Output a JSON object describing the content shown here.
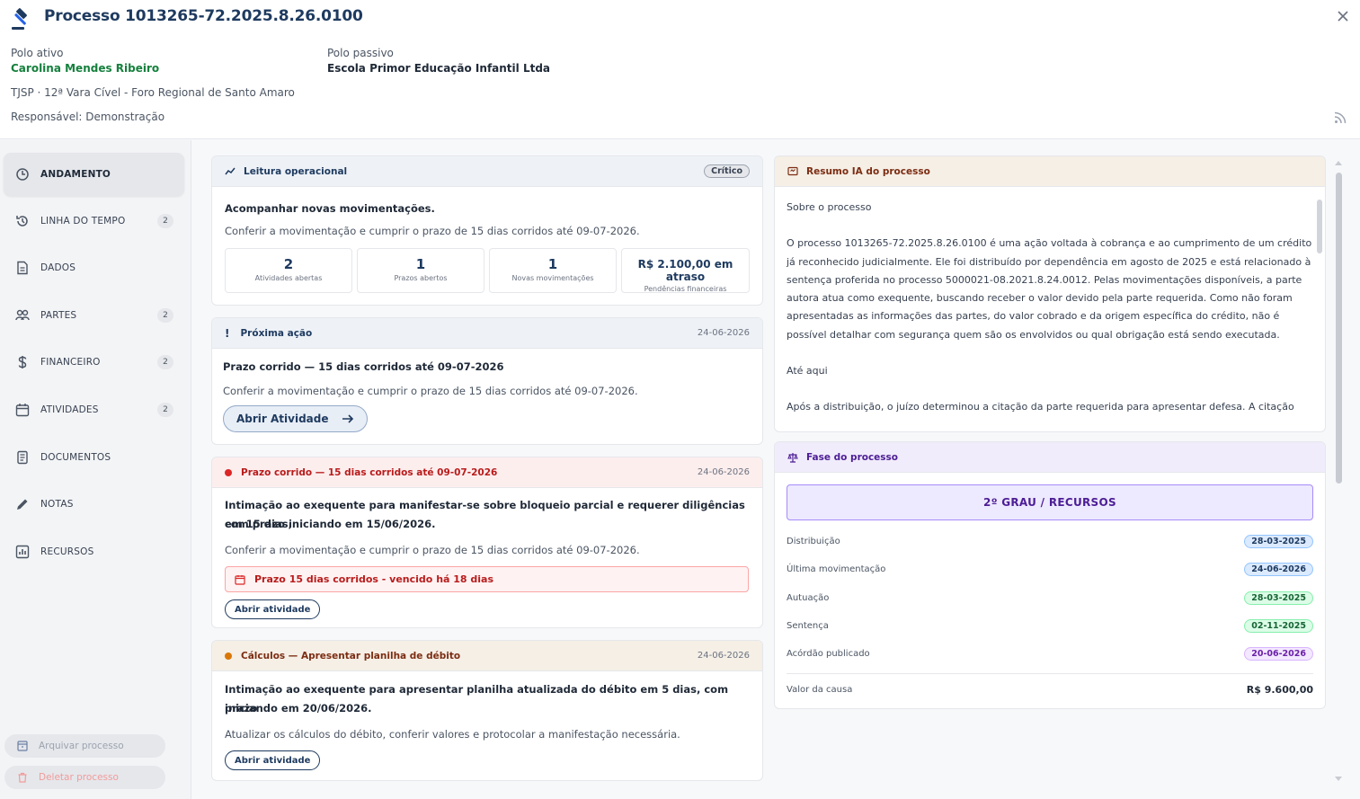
{
  "header": {
    "title": "Processo 1013265-72.2025.8.26.0100",
    "polo_ativo_label": "Polo ativo",
    "polo_ativo_name": "Carolina Mendes Ribeiro",
    "polo_passivo_label": "Polo passivo",
    "polo_passivo_name": "Escola Primor Educação Infantil Ltda",
    "court": "TJSP · 12ª Vara Cível - Foro Regional de Santo Amaro",
    "responsible": "Responsável: Demonstração"
  },
  "sidebar": {
    "items": [
      {
        "label": "ANDAMENTO",
        "count": "",
        "icon": "clock-icon"
      },
      {
        "label": "LINHA DO TEMPO",
        "count": "2",
        "icon": "history-icon"
      },
      {
        "label": "DADOS",
        "count": "",
        "icon": "document-icon"
      },
      {
        "label": "PARTES",
        "count": "2",
        "icon": "users-icon"
      },
      {
        "label": "FINANCEIRO",
        "count": "2",
        "icon": "dollar-icon"
      },
      {
        "label": "ATIVIDADES",
        "count": "2",
        "icon": "calendar-icon"
      },
      {
        "label": "DOCUMENTOS",
        "count": "",
        "icon": "file-icon"
      },
      {
        "label": "NOTAS",
        "count": "",
        "icon": "pencil-icon"
      },
      {
        "label": "RECURSOS",
        "count": "",
        "icon": "chart-icon"
      }
    ],
    "archive_label": "Arquivar processo",
    "delete_label": "Deletar processo"
  },
  "operational": {
    "title": "Leitura operacional",
    "badge": "Crítico",
    "headline": "Acompanhar novas movimentações.",
    "desc": "Conferir a movimentação e cumprir o prazo de 15 dias corridos até 09-07-2026.",
    "stats": [
      {
        "value": "2",
        "label": "Atividades abertas"
      },
      {
        "value": "1",
        "label": "Prazos abertos"
      },
      {
        "value": "1",
        "label": "Novas movimentações"
      },
      {
        "value": "R$ 2.100,00 em atraso",
        "label": "Pendências financeiras"
      }
    ]
  },
  "next_action": {
    "title": "Próxima ação",
    "date": "24-06-2026",
    "headline": "Prazo corrido — 15 dias corridos até 09-07-2026",
    "desc": "Conferir a movimentação e cumprir o prazo de 15 dias corridos até 09-07-2026.",
    "button": "Abrir Atividade"
  },
  "deadline_card": {
    "title": "Prazo corrido — 15 dias corridos até 09-07-2026",
    "date": "24-06-2026",
    "text1": "Intimação ao exequente para manifestar-se sobre bloqueio parcial e requerer diligências em 15 dias,",
    "text2": "com prazo iniciando em 15/06/2026.",
    "desc": "Conferir a movimentação e cumprir o prazo de 15 dias corridos até 09-07-2026.",
    "alert": "Prazo 15 dias corridos - vencido há 18 dias",
    "button": "Abrir atividade"
  },
  "calc_card": {
    "title": "Cálculos — Apresentar planilha de débito",
    "date": "24-06-2026",
    "text1": "Intimação ao exequente para apresentar planilha atualizada do débito em 5 dias, com prazo",
    "text2": "iniciando em 20/06/2026.",
    "desc": "Atualizar os cálculos do débito, conferir valores e protocolar a manifestação necessária.",
    "button": "Abrir atividade"
  },
  "ai_summary": {
    "title": "Resumo IA do processo",
    "p1": "Sobre o processo",
    "p2": "O processo 1013265-72.2025.8.26.0100 é uma ação voltada à cobrança e ao cumprimento de um crédito já reconhecido judicialmente. Ele foi distribuído por dependência em agosto de 2025 e está relacionado à sentença proferida no processo 5000021-08.2021.8.24.0012. Pelas movimentações disponíveis, a parte autora atua como exequente, buscando receber o valor devido pela parte requerida. Como não foram apresentadas as informações das partes, do valor cobrado e da origem específica do crédito, não é possível detalhar com segurança quem são os envolvidos ou qual obrigação está sendo executada.",
    "p3": "Até aqui",
    "p4": "Após a distribuição, o juízo determinou a citação da parte requerida para apresentar defesa. A citação"
  },
  "phase": {
    "title": "Fase do processo",
    "current": "2º GRAU / RECURSOS",
    "rows": [
      {
        "label": "Distribuição",
        "value": "28-03-2025"
      },
      {
        "label": "Última movimentação",
        "value": "24-06-2026"
      },
      {
        "label": "Autuação",
        "value": "28-03-2025"
      },
      {
        "label": "Sentença",
        "value": "02-11-2025"
      },
      {
        "label": "Acórdão publicado",
        "value": "20-06-2026"
      }
    ],
    "value_label": "Valor da causa",
    "value": "R$ 9.600,00"
  },
  "colors": {
    "primary": "#1e3a5f",
    "green": "#15803d",
    "red": "#b91c1c"
  }
}
